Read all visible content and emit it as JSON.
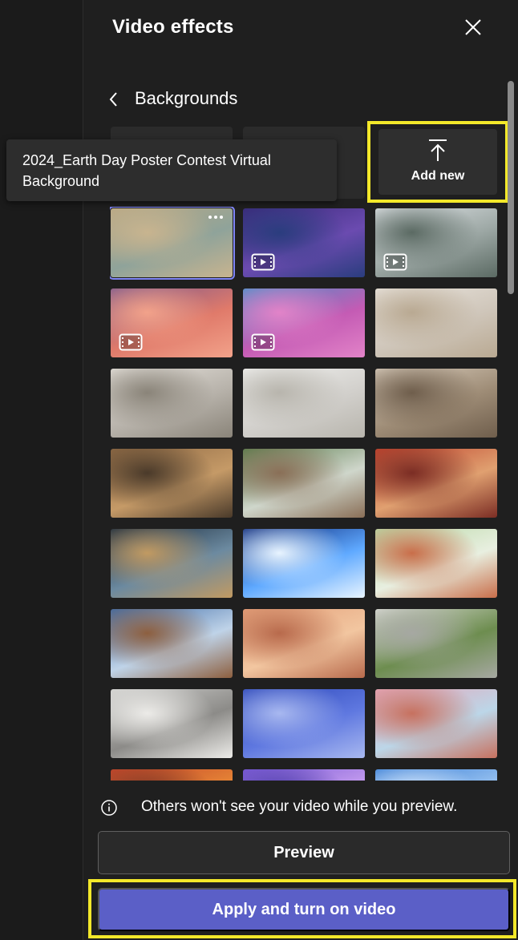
{
  "header": {
    "title": "Video effects",
    "close_icon": "close-icon"
  },
  "section": {
    "back_icon": "chevron-left-icon",
    "title": "Backgrounds"
  },
  "add_new": {
    "icon": "upload-icon",
    "label": "Add new"
  },
  "tooltip": {
    "text": "2024_Earth Day Poster Contest Virtual Background"
  },
  "backgrounds": [
    {
      "name": "earth-day-poster-collage",
      "video": false,
      "selected": true,
      "more_icon": true,
      "colors": [
        "#b9a884",
        "#8fa39a",
        "#c8b48f"
      ]
    },
    {
      "name": "purple-mountain-lake",
      "video": true,
      "colors": [
        "#3b2a7a",
        "#6b4bb0",
        "#2a3d7e"
      ]
    },
    {
      "name": "snowy-forest-clouds",
      "video": true,
      "colors": [
        "#dfe3e6",
        "#9ca7a4",
        "#5b6a63"
      ]
    },
    {
      "name": "sunset-pink-clouds",
      "video": true,
      "colors": [
        "#7e5a8c",
        "#e07a6a",
        "#f2a28a"
      ]
    },
    {
      "name": "pink-flowers-blue-sky",
      "video": true,
      "colors": [
        "#4c8fc8",
        "#c45bb4",
        "#e283c8"
      ]
    },
    {
      "name": "minimal-white-room",
      "video": false,
      "colors": [
        "#e9e4dd",
        "#cfc6ba",
        "#b9a992"
      ]
    },
    {
      "name": "bright-living-room",
      "video": false,
      "colors": [
        "#e6e2dc",
        "#b7b2aa",
        "#8a8479"
      ]
    },
    {
      "name": "white-arched-hall",
      "video": false,
      "colors": [
        "#f0f0ee",
        "#d2d0cc",
        "#b8b5ad"
      ]
    },
    {
      "name": "cozy-lounge",
      "video": false,
      "colors": [
        "#d9cdbd",
        "#9e8c76",
        "#6f5e4c"
      ]
    },
    {
      "name": "dining-room-fireplace",
      "video": false,
      "colors": [
        "#8f6a45",
        "#c59a67",
        "#4a3a2a"
      ]
    },
    {
      "name": "glass-atrium-garden",
      "video": false,
      "colors": [
        "#5b7d4d",
        "#cfd6cb",
        "#8a6f57"
      ]
    },
    {
      "name": "red-orange-room",
      "video": false,
      "colors": [
        "#c0442e",
        "#e0a070",
        "#7b2d24"
      ]
    },
    {
      "name": "space-crater-planet",
      "video": false,
      "colors": [
        "#1b2b3c",
        "#6c8aa0",
        "#c19a62"
      ]
    },
    {
      "name": "spaceship-light-burst",
      "video": false,
      "colors": [
        "#0d2a7a",
        "#5fa9ff",
        "#e8f4ff"
      ]
    },
    {
      "name": "green-arch-corridor",
      "video": false,
      "colors": [
        "#b9d9a6",
        "#e8efe0",
        "#c96e4a"
      ]
    },
    {
      "name": "blue-modern-lounge",
      "video": false,
      "colors": [
        "#3f6ca8",
        "#bfd3e8",
        "#8d5f3f"
      ]
    },
    {
      "name": "desert-arch",
      "video": false,
      "colors": [
        "#e4a07a",
        "#f2c6a0",
        "#b86a4c"
      ]
    },
    {
      "name": "circular-portal-forest",
      "video": false,
      "colors": [
        "#d7d8d2",
        "#6d8d4f",
        "#a6a8a2"
      ]
    },
    {
      "name": "grey-arch-niche",
      "video": false,
      "colors": [
        "#cfcfcd",
        "#8c8b88",
        "#ecebe8"
      ]
    },
    {
      "name": "blue-window-room",
      "video": false,
      "colors": [
        "#2c47b8",
        "#5f78e0",
        "#a8b8f0"
      ]
    },
    {
      "name": "pink-tree-pillars",
      "video": false,
      "colors": [
        "#e6a6b8",
        "#bcd6e8",
        "#c7715f"
      ]
    },
    {
      "name": "autumn-leaves",
      "video": false,
      "colors": [
        "#c4472c",
        "#e98a36",
        "#7a3424"
      ]
    },
    {
      "name": "purple-abstract",
      "video": false,
      "colors": [
        "#7b5bd6",
        "#c9a0f0",
        "#4a3aa8"
      ]
    },
    {
      "name": "blue-sky-partial",
      "video": false,
      "colors": [
        "#3a7fd6",
        "#9ec6f2",
        "#d9e9fb"
      ]
    }
  ],
  "info": {
    "icon": "info-icon",
    "text": "Others won't see your video while you preview."
  },
  "buttons": {
    "preview_label": "Preview",
    "apply_label": "Apply and turn on video"
  },
  "colors": {
    "accent": "#5b5fc7",
    "highlight": "#f3e82a",
    "background": "#1f1f1f",
    "selected_outline": "#7f85f5"
  }
}
